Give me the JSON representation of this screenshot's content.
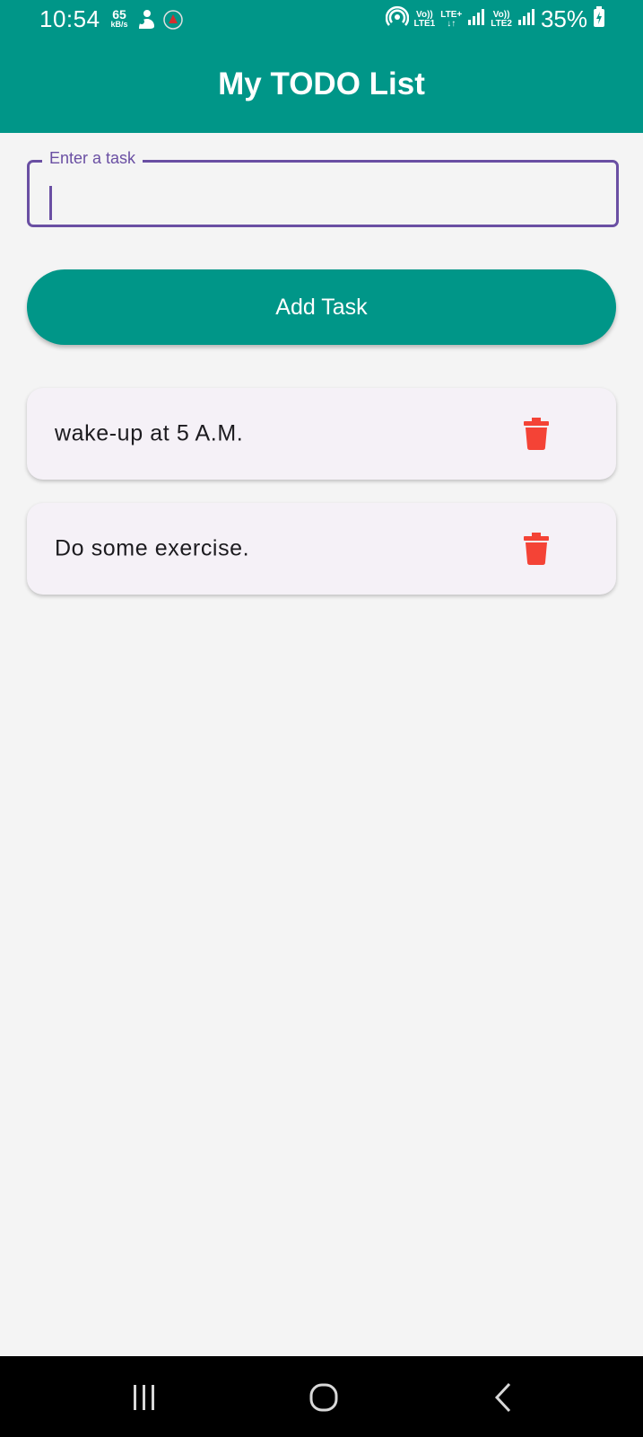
{
  "status_bar": {
    "time": "10:54",
    "net_speed": "65",
    "net_speed_unit": "kB/s",
    "sim1_label_top": "Vo))",
    "sim1_label_bottom": "LTE1",
    "sim1_network": "LTE+",
    "sim2_label_top": "Vo))",
    "sim2_label_bottom": "LTE2",
    "battery": "35%"
  },
  "app_bar": {
    "title": "My TODO List",
    "color": "#009688"
  },
  "task_input": {
    "label": "Enter a task",
    "value": "",
    "border_color": "#6a4fa3"
  },
  "add_button": {
    "label": "Add Task"
  },
  "tasks": [
    {
      "text": "wake-up at 5 A.M.",
      "delete_icon": "trash-icon"
    },
    {
      "text": "Do some exercise.",
      "delete_icon": "trash-icon"
    }
  ],
  "delete_color": "#f44336",
  "nav_bar": {
    "items": [
      "recents-icon",
      "home-icon",
      "back-icon"
    ]
  }
}
